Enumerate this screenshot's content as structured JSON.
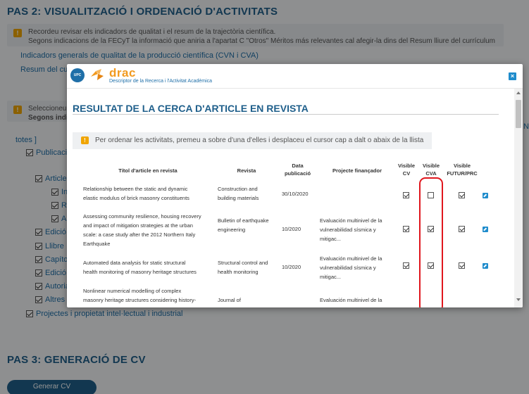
{
  "page": {
    "pas2_title": "PAS 2: VISUALITZACIÓ I ORDENACIÓ D'ACTIVITATS",
    "notice1_line1": "Recordeu revisar els indicadors de qualitat i el resum de la trajectòria científica.",
    "notice1_line2": "Segons indicacions de la FECyT la informació que aniria a l'apartat C \"Otros\" Méritos más relevantes cal afegir-la dins del Resum lliure del currículum",
    "link_indicadors": "Indicadors generals de qualitat de la producció científica (CVN i CVA)",
    "link_resum": "Resum del currículum",
    "notice2_line1": "Seleccioneu",
    "notice2_line2": "Segons indicacions",
    "totes": "totes ]",
    "tree": {
      "publicacions": "Publicacions",
      "article": "Article",
      "in": "In",
      "re": "Re",
      "al": "Al",
      "edicio1": "Edició",
      "llibre": "Llibre",
      "capitol": "Capítol",
      "edicio2": "Edició",
      "autoria": "Autoria",
      "altres": "Altres",
      "projectes_pi": "Projectes i propietat intel·lectual i industrial"
    },
    "right_edge": "N",
    "pas3_title": "PAS 3: GENERACIÓ DE CV",
    "generate_button": "Generar CV"
  },
  "modal": {
    "brand": "drac",
    "brand_sub": "Descriptor de la Recerca i l'Activitat Acadèmica",
    "upc": "UPC",
    "close": "×",
    "title": "RESULTAT DE LA CERCA D'ARTICLE EN REVISTA",
    "info": "Per ordenar les activitats, premeu a sobre d'una d'elles i desplaceu el cursor cap a dalt o abaix de la llista",
    "columns": {
      "title": "Títol d'article en revista",
      "journal": "Revista",
      "date_1": "Data",
      "date_2": "publicació",
      "project": "Projecte finançador",
      "cv_1": "Visible",
      "cv_2": "CV",
      "cva_1": "Visible",
      "cva_2": "CVA",
      "futur_1": "Visible",
      "futur_2": "FUTUR/PRC"
    },
    "rows": [
      {
        "title_1": "Relationship between the static and dynamic",
        "title_2": "elastic modulus of brick masonry constituents",
        "title_3": "",
        "title_4": "",
        "journal_1": "Construction and",
        "journal_2": "building materials",
        "date": "30/10/2020",
        "project_1": "",
        "project_2": "",
        "project_3": "",
        "cv": true,
        "cva": false,
        "futur": true
      },
      {
        "title_1": "Assessing community resilience, housing recovery",
        "title_2": "and impact of mitigation strategies at the urban",
        "title_3": "scale: a case study after the 2012 Northern Italy",
        "title_4": "Earthquake",
        "journal_1": "Bulletin of earthquake",
        "journal_2": "engineering",
        "date": "10/2020",
        "project_1": "Evaluación multinivel de la",
        "project_2": "vulnerabilidad sísmica y",
        "project_3": "mitigac...",
        "cv": true,
        "cva": true,
        "futur": true
      },
      {
        "title_1": "Automated data analysis for static structural",
        "title_2": "health monitoring of masonry heritage structures",
        "title_3": "",
        "title_4": "",
        "journal_1": "Structural control and",
        "journal_2": "health monitoring",
        "date": "10/2020",
        "project_1": "Evaluación multinivel de la",
        "project_2": "vulnerabilidad sísmica y",
        "project_3": "mitigac...",
        "cv": true,
        "cva": true,
        "futur": true
      },
      {
        "title_1": "Nonlinear numerical modelling of complex",
        "title_2": "masonry heritage structures considering history-",
        "title_3": "",
        "title_4": "",
        "journal_1": "",
        "journal_2": "Journal of",
        "date": "",
        "project_1": "",
        "project_2": "Evaluación multinivel de la",
        "project_3": "",
        "cv": null,
        "cva": null,
        "futur": null
      }
    ]
  },
  "colors": {
    "primary": "#1f5f8b",
    "link": "#1f6fa8",
    "accent_orange": "#f29a1f",
    "highlight_red": "#e0161d"
  }
}
